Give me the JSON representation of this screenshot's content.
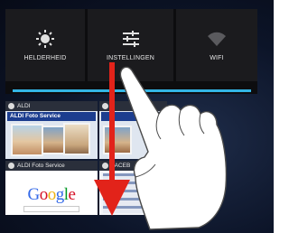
{
  "quick_settings": {
    "tiles": [
      {
        "label": "HELDERHEID",
        "icon": "brightness-icon"
      },
      {
        "label": "INSTELLINGEN",
        "icon": "settings-sliders-icon"
      },
      {
        "label": "WIFI",
        "icon": "wifi-icon"
      }
    ],
    "brightness_level_color": "#33b5e5"
  },
  "recent_apps": [
    {
      "title": "ALDI",
      "banner": "ALDI Foto Service"
    },
    {
      "title": "ALDI Foto Service"
    },
    {
      "title": "",
      "logo": "Google"
    },
    {
      "title": "FACEB"
    }
  ],
  "colors": {
    "arrow": "#e2231a",
    "accent": "#33b5e5"
  }
}
